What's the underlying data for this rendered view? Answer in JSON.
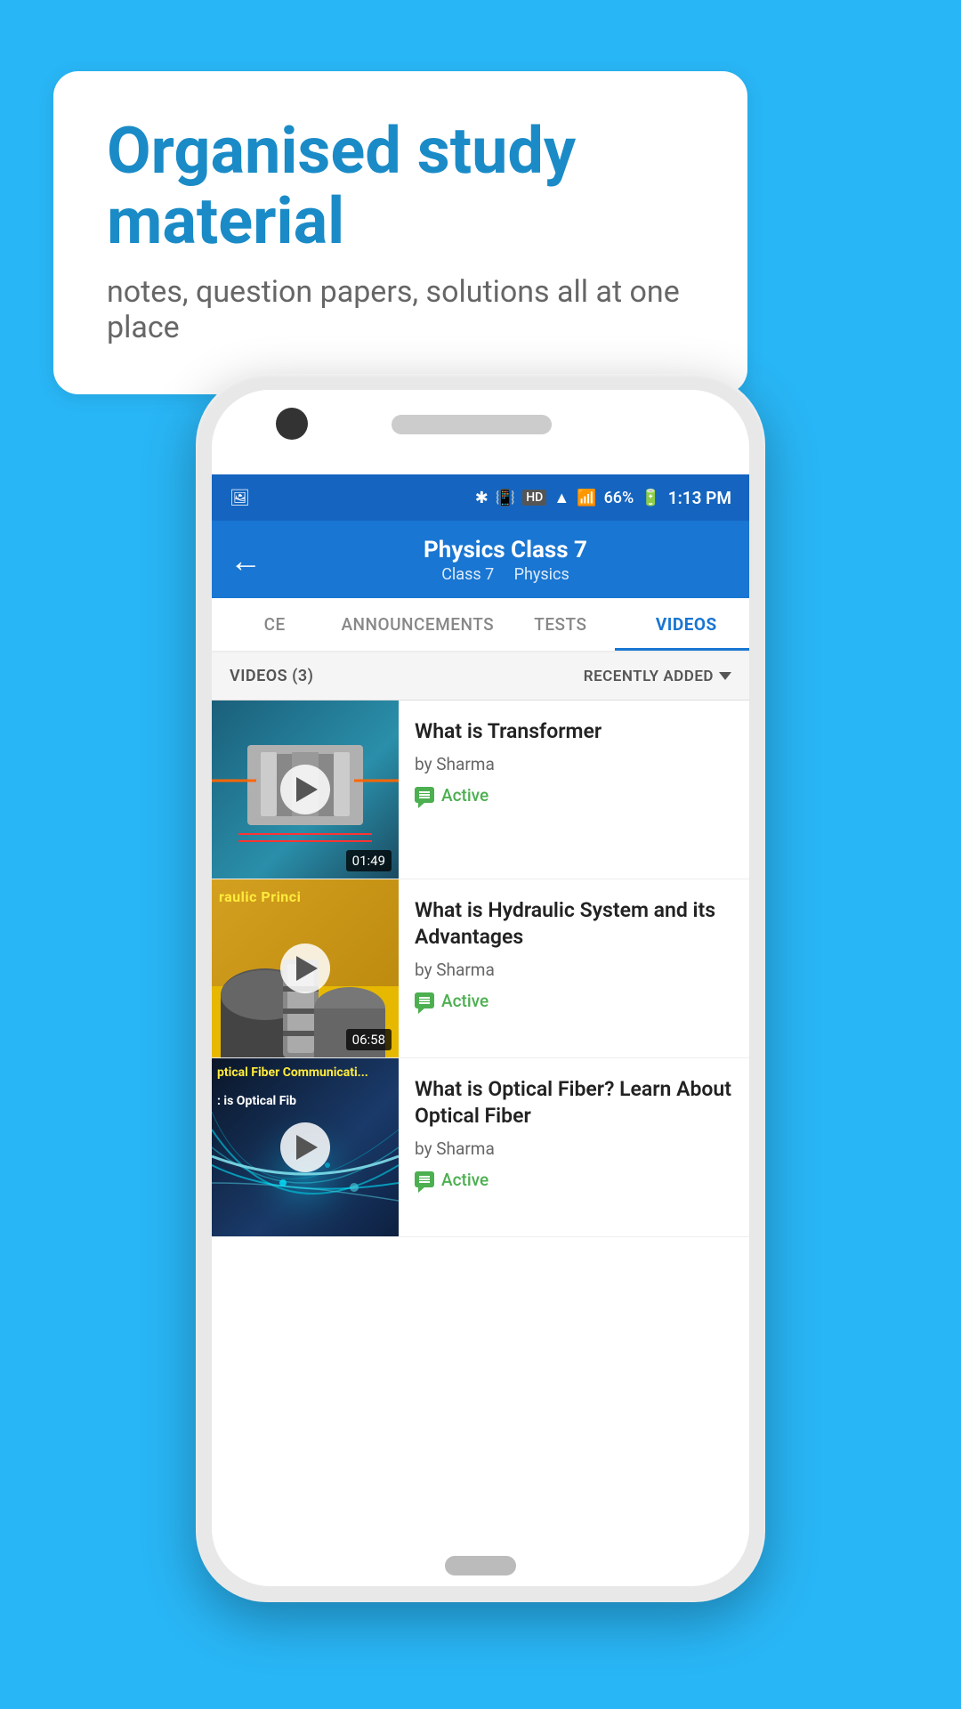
{
  "background_color": "#29b6f6",
  "speech_bubble": {
    "title": "Organised study material",
    "subtitle": "notes, question papers, solutions all at one place"
  },
  "phone": {
    "status_bar": {
      "time": "1:13 PM",
      "battery": "66%",
      "signal_icons": "HD"
    },
    "header": {
      "title": "Physics Class 7",
      "subtitle_part1": "Class 7",
      "subtitle_separator": "   ",
      "subtitle_part2": "Physics",
      "back_label": "←"
    },
    "tabs": [
      {
        "label": "CE",
        "active": false
      },
      {
        "label": "ANNOUNCEMENTS",
        "active": false
      },
      {
        "label": "TESTS",
        "active": false
      },
      {
        "label": "VIDEOS",
        "active": true
      }
    ],
    "filter_bar": {
      "count_label": "VIDEOS (3)",
      "sort_label": "RECENTLY ADDED"
    },
    "videos": [
      {
        "title": "What is  Transformer",
        "author": "by Sharma",
        "status": "Active",
        "duration": "01:49",
        "thumb_type": "transformer"
      },
      {
        "title": "What is Hydraulic System and its Advantages",
        "author": "by Sharma",
        "status": "Active",
        "duration": "06:58",
        "thumb_type": "hydraulic"
      },
      {
        "title": "What is Optical Fiber? Learn About Optical Fiber",
        "author": "by Sharma",
        "status": "Active",
        "duration": "",
        "thumb_type": "optical"
      }
    ]
  }
}
